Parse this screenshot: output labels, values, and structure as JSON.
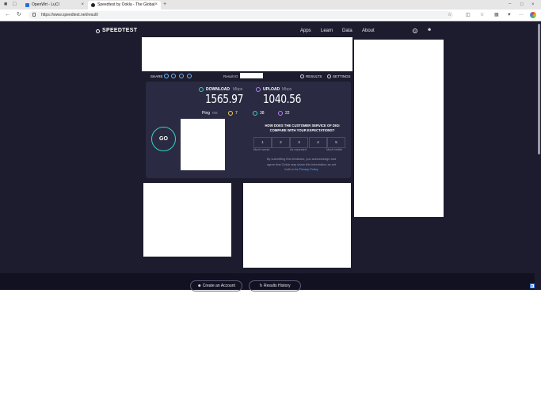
{
  "browser": {
    "tabs": [
      {
        "title": "OpenWrt - LuCI"
      },
      {
        "title": "Speedtest by Ookla - The Global"
      }
    ],
    "url": "https://www.speedtest.net/result/"
  },
  "header": {
    "logo": "SPEEDTEST",
    "nav": [
      "Apps",
      "Learn",
      "Data",
      "About"
    ]
  },
  "share": {
    "label": "SHARE",
    "result_id_label": "Result ID",
    "results_label": "RESULTS",
    "settings_label": "SETTINGS"
  },
  "speed": {
    "download_label": "DOWNLOAD",
    "download_unit": "Mbps",
    "download_value": "1565.97",
    "upload_label": "UPLOAD",
    "upload_unit": "Mbps",
    "upload_value": "1040.56",
    "ping_label": "Ping",
    "ping_unit": "ms",
    "ping_idle": "7",
    "ping_download": "38",
    "ping_upload": "22",
    "go_label": "GO"
  },
  "survey": {
    "question_line1": "HOW DOES THE CUSTOMER SERVICE OF DIGI",
    "question_line2": "COMPARE WITH YOUR EXPECTATIONS?",
    "options": [
      "1",
      "2",
      "3",
      "4",
      "5"
    ],
    "scale_low": "Much worse",
    "scale_mid": "As expected",
    "scale_high": "Much better",
    "disclaimer_line1": "By submitting this feedback, you acknowledge and",
    "disclaimer_line2": "agree that Ookla may share this information as set",
    "disclaimer_line3_prefix": "forth in its",
    "privacy_link": "Privacy Policy"
  },
  "footer": {
    "create_account": "Create an Account",
    "results_history": "Results History"
  },
  "colors": {
    "page_bg": "#1c1c2e",
    "card_bg": "#2a2b42",
    "download_accent": "#34d1c5",
    "upload_accent": "#b681f5",
    "link": "#5aa9ff"
  }
}
